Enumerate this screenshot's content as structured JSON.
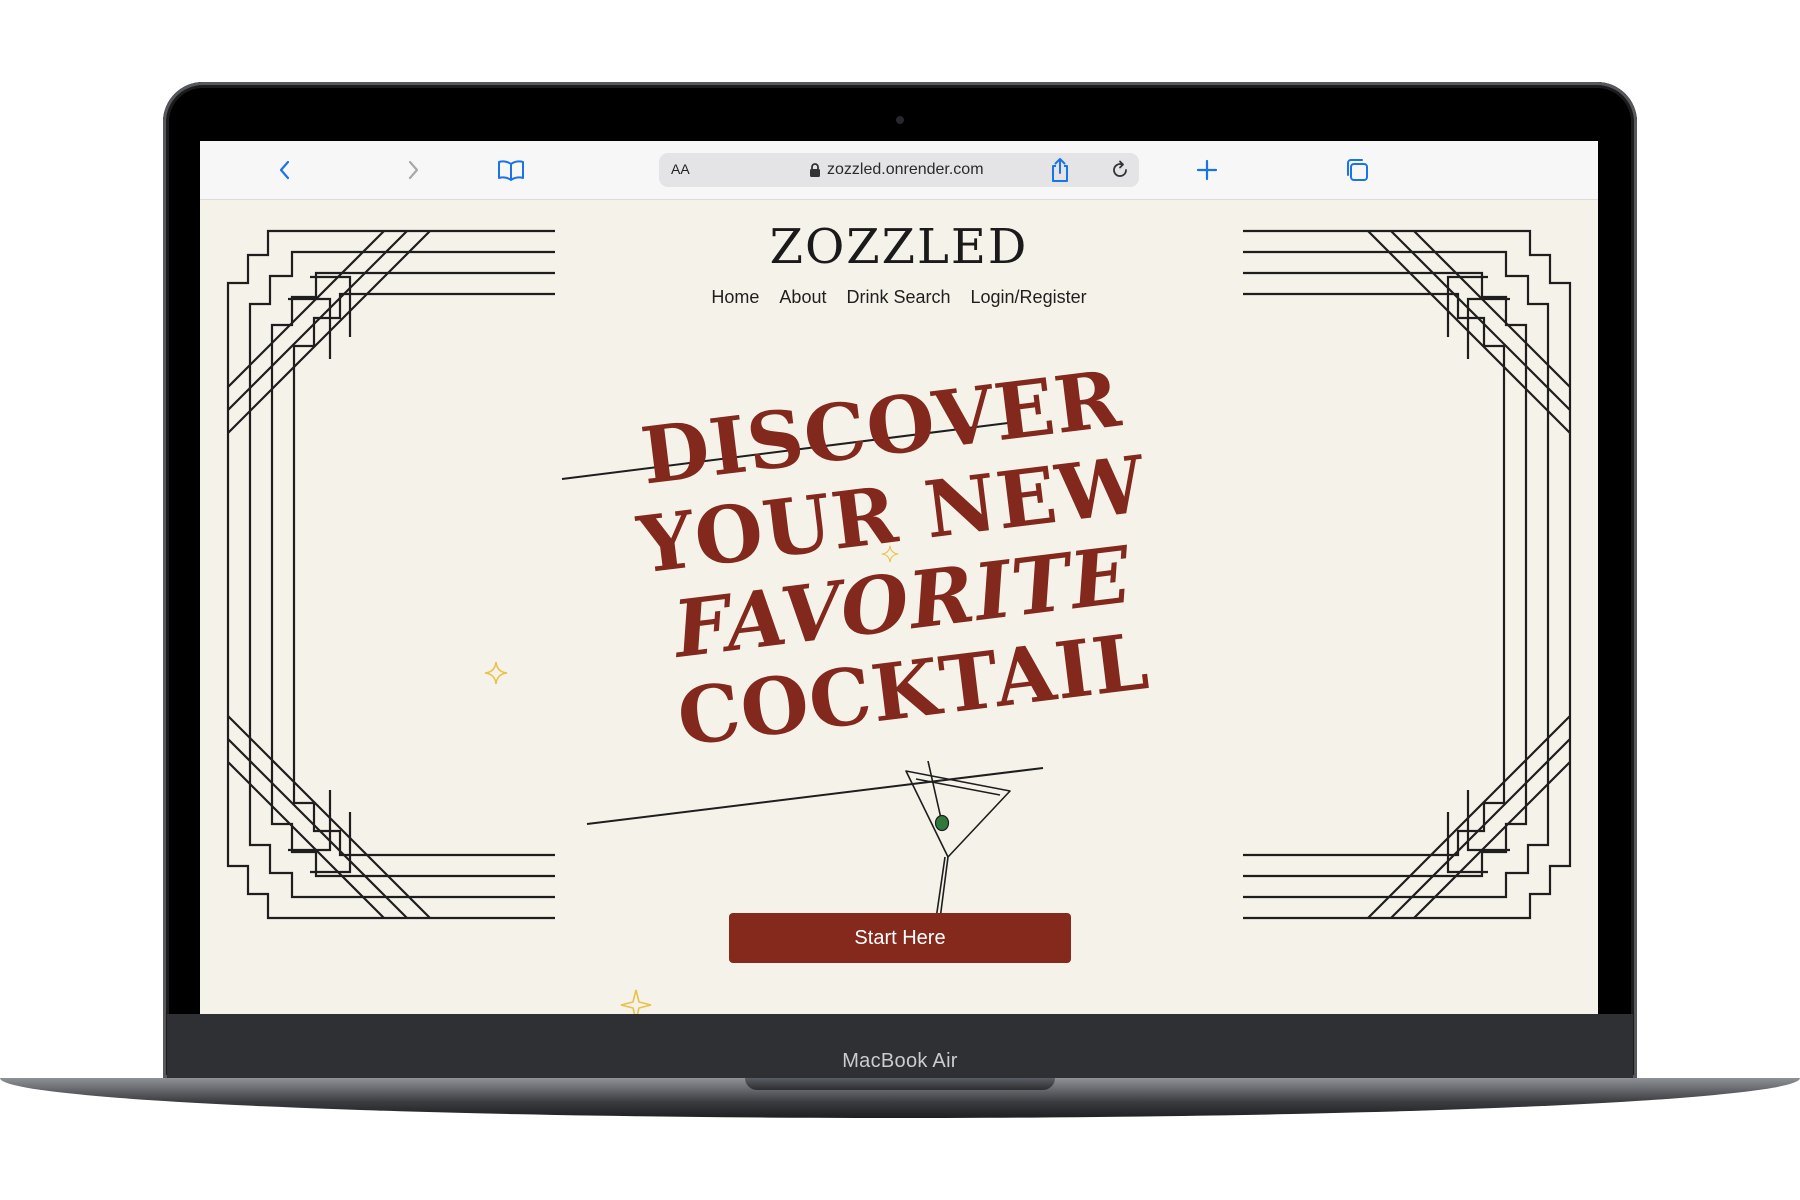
{
  "device": {
    "label": "MacBook Air"
  },
  "browser": {
    "text_size_label": "AA",
    "url": "zozzled.onrender.com",
    "icons": {
      "back": "chevron-left-icon",
      "forward": "chevron-right-icon",
      "bookmarks": "book-icon",
      "lock": "lock-icon",
      "reload": "reload-icon",
      "share": "share-icon",
      "new_tab": "plus-icon",
      "tabs": "tabs-icon"
    },
    "accent_color": "#1a73e8"
  },
  "site": {
    "logo": "ZOZZLED",
    "nav": [
      {
        "label": "Home"
      },
      {
        "label": "About"
      },
      {
        "label": "Drink Search"
      },
      {
        "label": "Login/Register"
      }
    ],
    "hero": {
      "lines": [
        "DISCOVER",
        "YOUR NEW",
        "FAVORITE",
        "COCKTAIL"
      ],
      "illustration": "martini-glass-icon"
    },
    "cta_label": "Start Here",
    "colors": {
      "background": "#f5f2e9",
      "accent": "#84291c",
      "line": "#1e1e1e",
      "sparkle": "#e8c24a"
    }
  }
}
